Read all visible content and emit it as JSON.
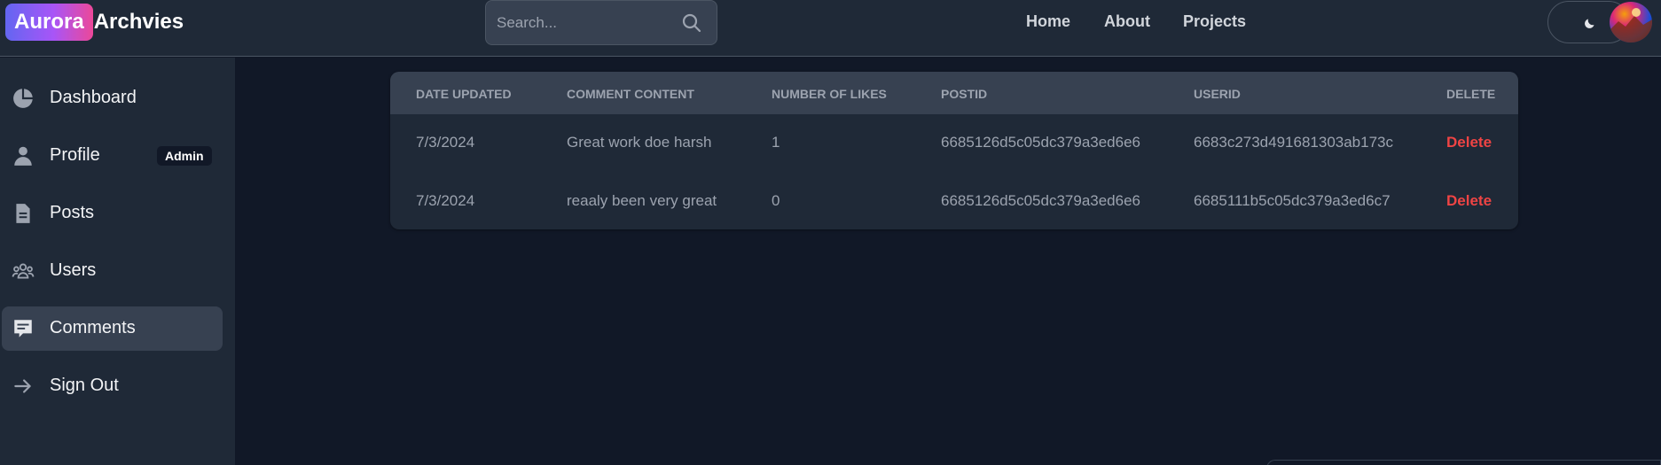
{
  "header": {
    "logo_badge": "Aurora",
    "logo_text": "Archvies",
    "search_placeholder": "Search...",
    "nav": [
      {
        "label": "Home"
      },
      {
        "label": "About"
      },
      {
        "label": "Projects"
      }
    ]
  },
  "sidebar": {
    "items": [
      {
        "label": "Dashboard",
        "icon": "pie-chart-icon"
      },
      {
        "label": "Profile",
        "icon": "user-icon",
        "badge": "Admin"
      },
      {
        "label": "Posts",
        "icon": "document-icon"
      },
      {
        "label": "Users",
        "icon": "users-group-icon"
      },
      {
        "label": "Comments",
        "icon": "comment-icon",
        "active": true
      },
      {
        "label": "Sign Out",
        "icon": "arrow-right-icon"
      }
    ]
  },
  "table": {
    "headers": [
      "Date updated",
      "Comment content",
      "Number of likes",
      "PostId",
      "UserId",
      "Delete"
    ],
    "rows": [
      {
        "date": "7/3/2024",
        "content": "Great work doe harsh",
        "likes": "1",
        "post_id": "6685126d5c05dc379a3ed6e6",
        "user_id": "6683c273d491681303ab173c",
        "action": "Delete"
      },
      {
        "date": "7/3/2024",
        "content": "reaaly been very great",
        "likes": "0",
        "post_id": "6685126d5c05dc379a3ed6e6",
        "user_id": "6685111b5c05dc379a3ed6c7",
        "action": "Delete"
      }
    ]
  },
  "colors": {
    "background": "#111827",
    "panel": "#1f2937",
    "table_header": "#374151",
    "delete": "#ef4444"
  }
}
